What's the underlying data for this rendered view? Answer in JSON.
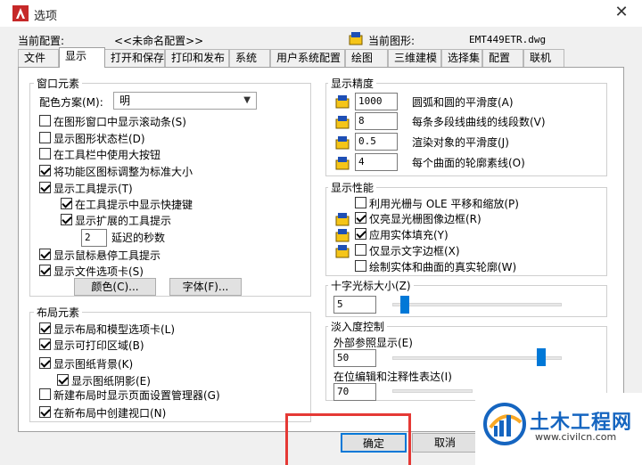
{
  "window": {
    "title": "选项"
  },
  "header": {
    "config_label": "当前配置:",
    "config_value": "<<未命名配置>>",
    "drawing_label": "当前图形:",
    "drawing_value": "EMT449ETR.dwg"
  },
  "tabs": [
    "文件",
    "显示",
    "打开和保存",
    "打印和发布",
    "系统",
    "用户系统配置",
    "绘图",
    "三维建模",
    "选择集",
    "配置",
    "联机"
  ],
  "active_tab": "显示",
  "window_elements": {
    "title": "窗口元素",
    "color_scheme_label": "配色方案(M):",
    "color_scheme_value": "明",
    "checkboxes": [
      {
        "label": "在图形窗口中显示滚动条(S)",
        "checked": false
      },
      {
        "label": "显示图形状态栏(D)",
        "checked": false
      },
      {
        "label": "在工具栏中使用大按钮",
        "checked": false
      },
      {
        "label": "将功能区图标调整为标准大小",
        "checked": true
      },
      {
        "label": "显示工具提示(T)",
        "checked": true
      },
      {
        "label": "在工具提示中显示快捷键",
        "checked": true
      },
      {
        "label": "显示扩展的工具提示",
        "checked": true
      },
      {
        "label": "显示鼠标悬停工具提示",
        "checked": true
      },
      {
        "label": "显示文件选项卡(S)",
        "checked": true
      }
    ],
    "delay_value": "2",
    "delay_label": "延迟的秒数",
    "colors_button": "颜色(C)...",
    "fonts_button": "字体(F)..."
  },
  "layout_elements": {
    "title": "布局元素",
    "checkboxes": [
      {
        "label": "显示布局和模型选项卡(L)",
        "checked": true
      },
      {
        "label": "显示可打印区域(B)",
        "checked": true
      },
      {
        "label": "显示图纸背景(K)",
        "checked": true
      },
      {
        "label": "显示图纸阴影(E)",
        "checked": true
      },
      {
        "label": "新建布局时显示页面设置管理器(G)",
        "checked": false
      },
      {
        "label": "在新布局中创建视口(N)",
        "checked": true
      }
    ]
  },
  "display_resolution": {
    "title": "显示精度",
    "rows": [
      {
        "value": "1000",
        "label": "圆弧和圆的平滑度(A)"
      },
      {
        "value": "8",
        "label": "每条多段线曲线的线段数(V)"
      },
      {
        "value": "0.5",
        "label": "渲染对象的平滑度(J)"
      },
      {
        "value": "4",
        "label": "每个曲面的轮廓素线(O)"
      }
    ]
  },
  "display_performance": {
    "title": "显示性能",
    "checkboxes": [
      {
        "label": "利用光栅与 OLE 平移和缩放(P)",
        "checked": false
      },
      {
        "label": "仅亮显光栅图像边框(R)",
        "checked": true
      },
      {
        "label": "应用实体填充(Y)",
        "checked": true
      },
      {
        "label": "仅显示文字边框(X)",
        "checked": false
      },
      {
        "label": "绘制实体和曲面的真实轮廓(W)",
        "checked": false
      }
    ]
  },
  "crosshair": {
    "title": "十字光标大小(Z)",
    "value": "5",
    "level_fraction": 0.05
  },
  "fade": {
    "title": "淡入度控制",
    "xref_label": "外部参照显示(E)",
    "xref_value": "50",
    "xref_fraction": 0.9,
    "inplace_label": "在位编辑和注释性表达(I)",
    "inplace_value": "70"
  },
  "footer": {
    "ok_label": "确定",
    "cancel_label": "取消"
  },
  "watermark": {
    "brand": "土木工程网",
    "url": "www.civilcn.com"
  },
  "colors": {
    "accent": "#0078d7",
    "highlight": "#e53935",
    "brand": "#1565c0"
  }
}
